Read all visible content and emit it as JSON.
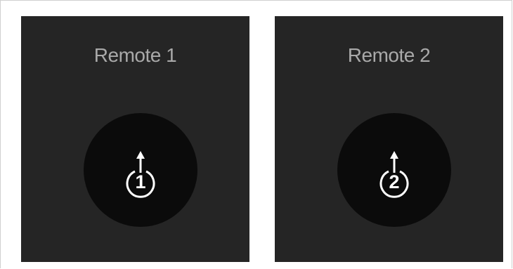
{
  "remotes": [
    {
      "title": "Remote 1",
      "number": "1",
      "icon": "power-up-icon"
    },
    {
      "title": "Remote 2",
      "number": "2",
      "icon": "power-up-icon"
    }
  ],
  "colors": {
    "panel_background": "#252525",
    "button_background": "#0b0b0b",
    "title_text": "#a9a9a9",
    "icon": "#ffffff",
    "page_background": "#ffffff"
  }
}
